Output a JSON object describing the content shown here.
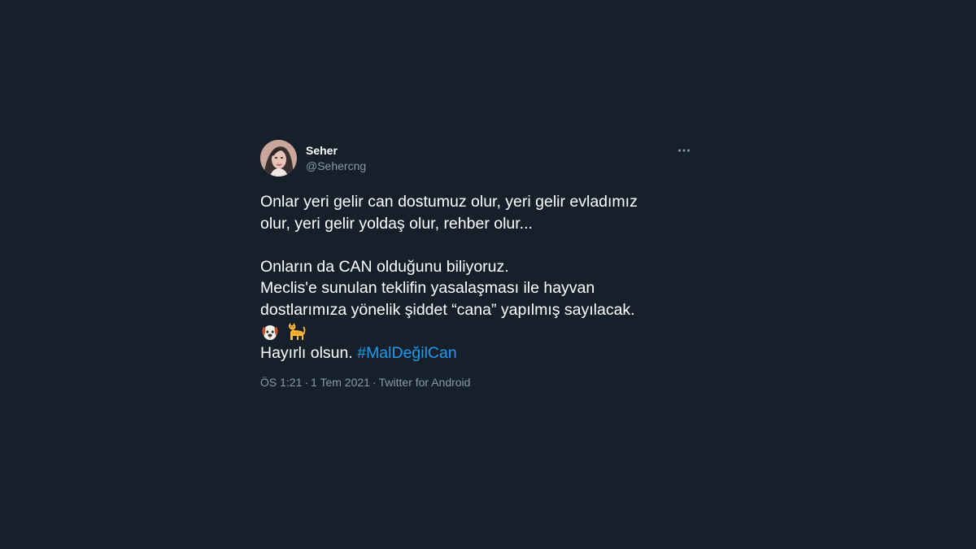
{
  "tweet": {
    "author": {
      "display_name": "Seher",
      "username": "@Sehercng"
    },
    "more_icon": "more-horizontal-icon",
    "text_lines": [
      "Onlar yeri gelir can dostumuz olur, yeri gelir evladımız",
      "olur, yeri gelir yoldaş olur, rehber olur...",
      "Onların da CAN olduğunu biliyoruz.",
      "Meclis'e sunulan teklifin yasalaşması ile hayvan",
      "dostlarımıza yönelik şiddet “cana” yapılmış sayılacak."
    ],
    "emojis": [
      "dog-face-emoji",
      "cat-emoji"
    ],
    "closing_text": "Hayırlı olsun.",
    "hashtag": "#MalDeğilCan",
    "meta": {
      "time": "ÖS 1:21",
      "separator": "·",
      "date": "1 Tem 2021",
      "source": "Twitter for Android"
    }
  },
  "colors": {
    "background": "#16202b",
    "text": "#ffffff",
    "secondary_text": "#8899a6",
    "link": "#1d9bf0"
  }
}
